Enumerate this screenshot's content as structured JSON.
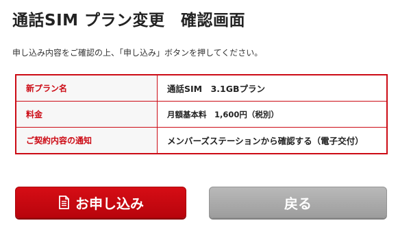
{
  "page": {
    "title": "通話SIM プラン変更　確認画面",
    "intro": "申し込み内容をご確認の上、「申し込み」ボタンを押してください。"
  },
  "summary": {
    "rows": [
      {
        "label": "新プラン名",
        "value": "通話SIM　3.1GBプラン"
      },
      {
        "label": "料金",
        "value": "月額基本料　1,600円（税別）"
      },
      {
        "label": "ご契約内容の通知",
        "value": "メンバーズステーションから確認する（電子交付）"
      }
    ]
  },
  "buttons": {
    "apply_label": "お申し込み",
    "apply_icon": "document-icon",
    "back_label": "戻る"
  },
  "colors": {
    "accent": "#cc0a14",
    "label_bg": "#f7f7f7",
    "back_button": "#a8a8a8"
  }
}
